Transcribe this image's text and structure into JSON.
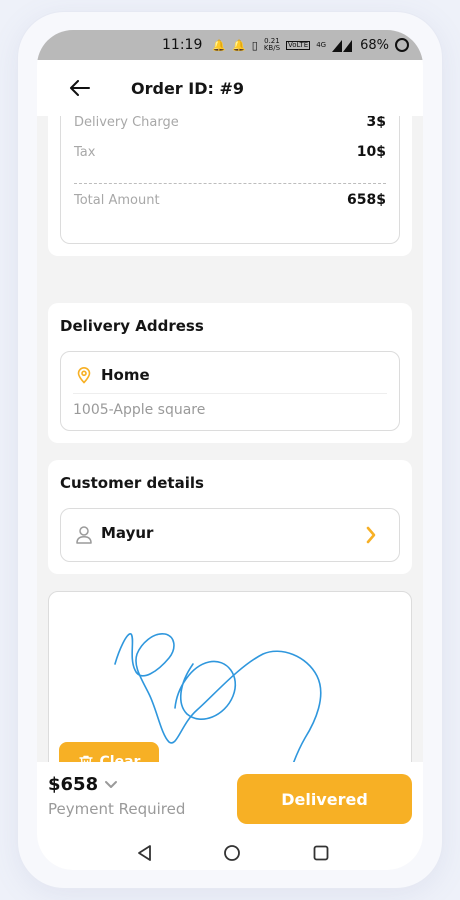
{
  "status_bar": {
    "time": "11:19",
    "speed_value": "0.21",
    "speed_unit": "KB/S",
    "volte": "VoLTE",
    "network": "4G",
    "battery": "68%"
  },
  "header": {
    "title": "Order ID: #9"
  },
  "summary": {
    "rows": [
      {
        "label": "Delivery Charge",
        "value": "3$"
      },
      {
        "label": "Tax",
        "value": "10$"
      }
    ],
    "total_label": "Total Amount",
    "total_value": "658$"
  },
  "delivery_address": {
    "title": "Delivery Address",
    "name": "Home",
    "line": "1005-Apple square"
  },
  "customer": {
    "title": "Customer details",
    "name": "Mayur"
  },
  "signature": {
    "clear_label": "Clear"
  },
  "footer": {
    "price": "$658",
    "payment_note": "Peyment Required",
    "action_label": "Delivered"
  },
  "colors": {
    "accent": "#F7B025",
    "signature_stroke": "#2F97DD"
  }
}
